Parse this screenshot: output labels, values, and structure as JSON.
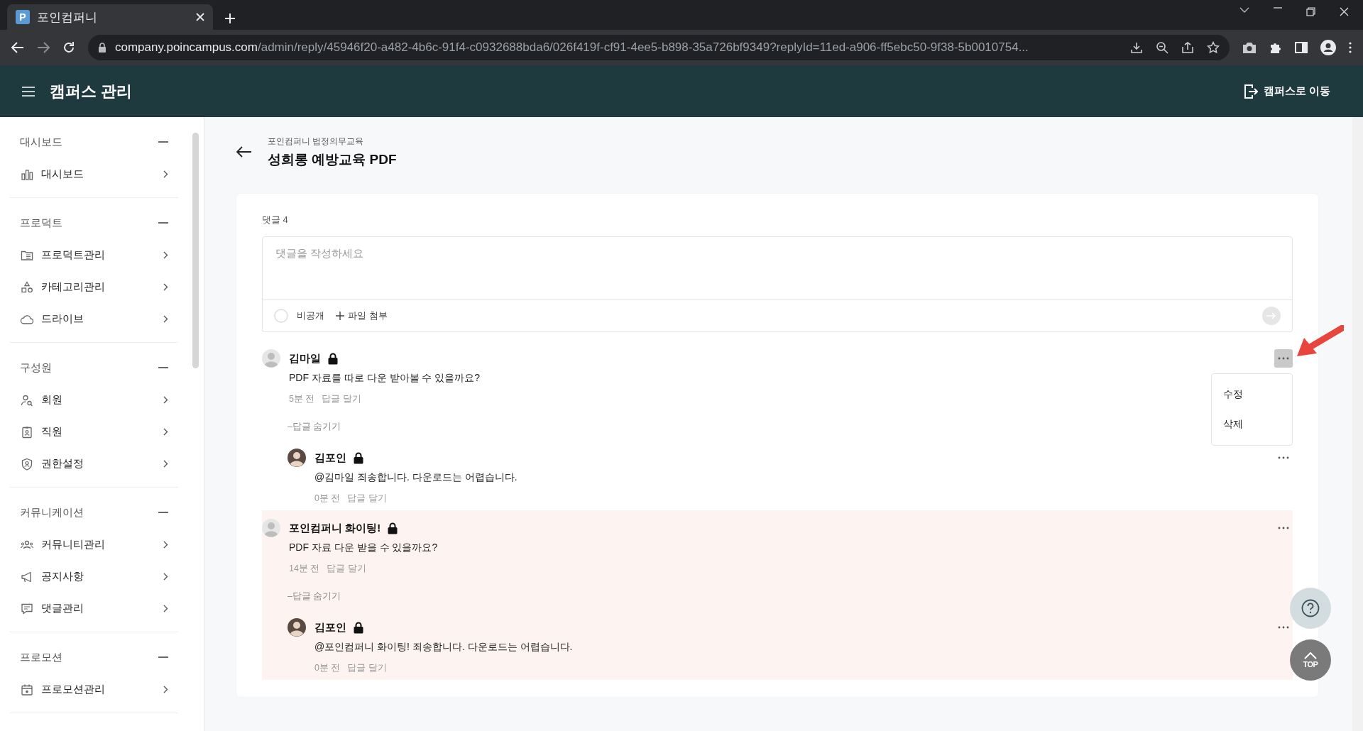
{
  "browser": {
    "tab_favicon": "P",
    "tab_title": "포인컴퍼니",
    "url_host": "company.poincampus.com",
    "url_path": "/admin/reply/45946f20-a482-4b6c-91f4-c0932688bda6/026f419f-cf91-4ee5-b898-35a726bf9349?replyId=11ed-a906-ff5ebc50-9f38-5b0010754..."
  },
  "header": {
    "title": "캠퍼스 관리",
    "campus_link": "캠퍼스로 이동"
  },
  "sidebar": {
    "sections": [
      {
        "title": "대시보드",
        "expanded": true,
        "items": [
          {
            "label": "대시보드"
          }
        ]
      },
      {
        "title": "프로덕트",
        "expanded": true,
        "items": [
          {
            "label": "프로덕트관리"
          },
          {
            "label": "카테고리관리"
          },
          {
            "label": "드라이브"
          }
        ]
      },
      {
        "title": "구성원",
        "expanded": true,
        "items": [
          {
            "label": "회원"
          },
          {
            "label": "직원"
          },
          {
            "label": "권한설정"
          }
        ]
      },
      {
        "title": "커뮤니케이션",
        "expanded": true,
        "items": [
          {
            "label": "커뮤니티관리"
          },
          {
            "label": "공지사항"
          },
          {
            "label": "댓글관리"
          }
        ]
      },
      {
        "title": "프로모션",
        "expanded": true,
        "items": [
          {
            "label": "프로모션관리"
          }
        ]
      }
    ]
  },
  "page": {
    "breadcrumb": "포인컴퍼니 법정의무교육",
    "title": "성희롱 예방교육 PDF"
  },
  "comments_panel": {
    "count_label": "댓글 4",
    "composer": {
      "placeholder": "댓글을 작성하세요",
      "private_label": "비공개",
      "private_checked": false,
      "attach_label": "파일 첨부"
    },
    "comments": [
      {
        "author": "김마일",
        "avatar": {
          "kind": "default"
        },
        "locked": true,
        "text": "PDF 자료를 따로 다운 받아볼 수 있을까요?",
        "time": "5분 전",
        "reply_action": "답글 달기",
        "highlighted": false,
        "menu_open": true,
        "menu": [
          "수정",
          "삭제"
        ],
        "replies_toggle": "–답글 숨기기",
        "replies": [
          {
            "author": "김포인",
            "avatar": {
              "kind": "photo"
            },
            "locked": true,
            "text": "@김마일 죄송합니다. 다운로드는 어렵습니다.",
            "time": "0분 전",
            "reply_action": "답글 달기",
            "menu_open": false
          }
        ]
      },
      {
        "author": "포인컴퍼니 화이팅!",
        "avatar": {
          "kind": "default"
        },
        "locked": true,
        "text": "PDF 자료 다운 받을 수 있을까요?",
        "time": "14분 전",
        "reply_action": "답글 달기",
        "highlighted": true,
        "menu_open": false,
        "replies_toggle": "–답글 숨기기",
        "replies": [
          {
            "author": "김포인",
            "avatar": {
              "kind": "photo"
            },
            "locked": true,
            "text": "@포인컴퍼니 화이팅! 죄송합니다. 다운로드는 어렵습니다.",
            "time": "0분 전",
            "reply_action": "답글 달기",
            "menu_open": false
          }
        ]
      }
    ]
  },
  "floating": {
    "top_label": "TOP"
  }
}
